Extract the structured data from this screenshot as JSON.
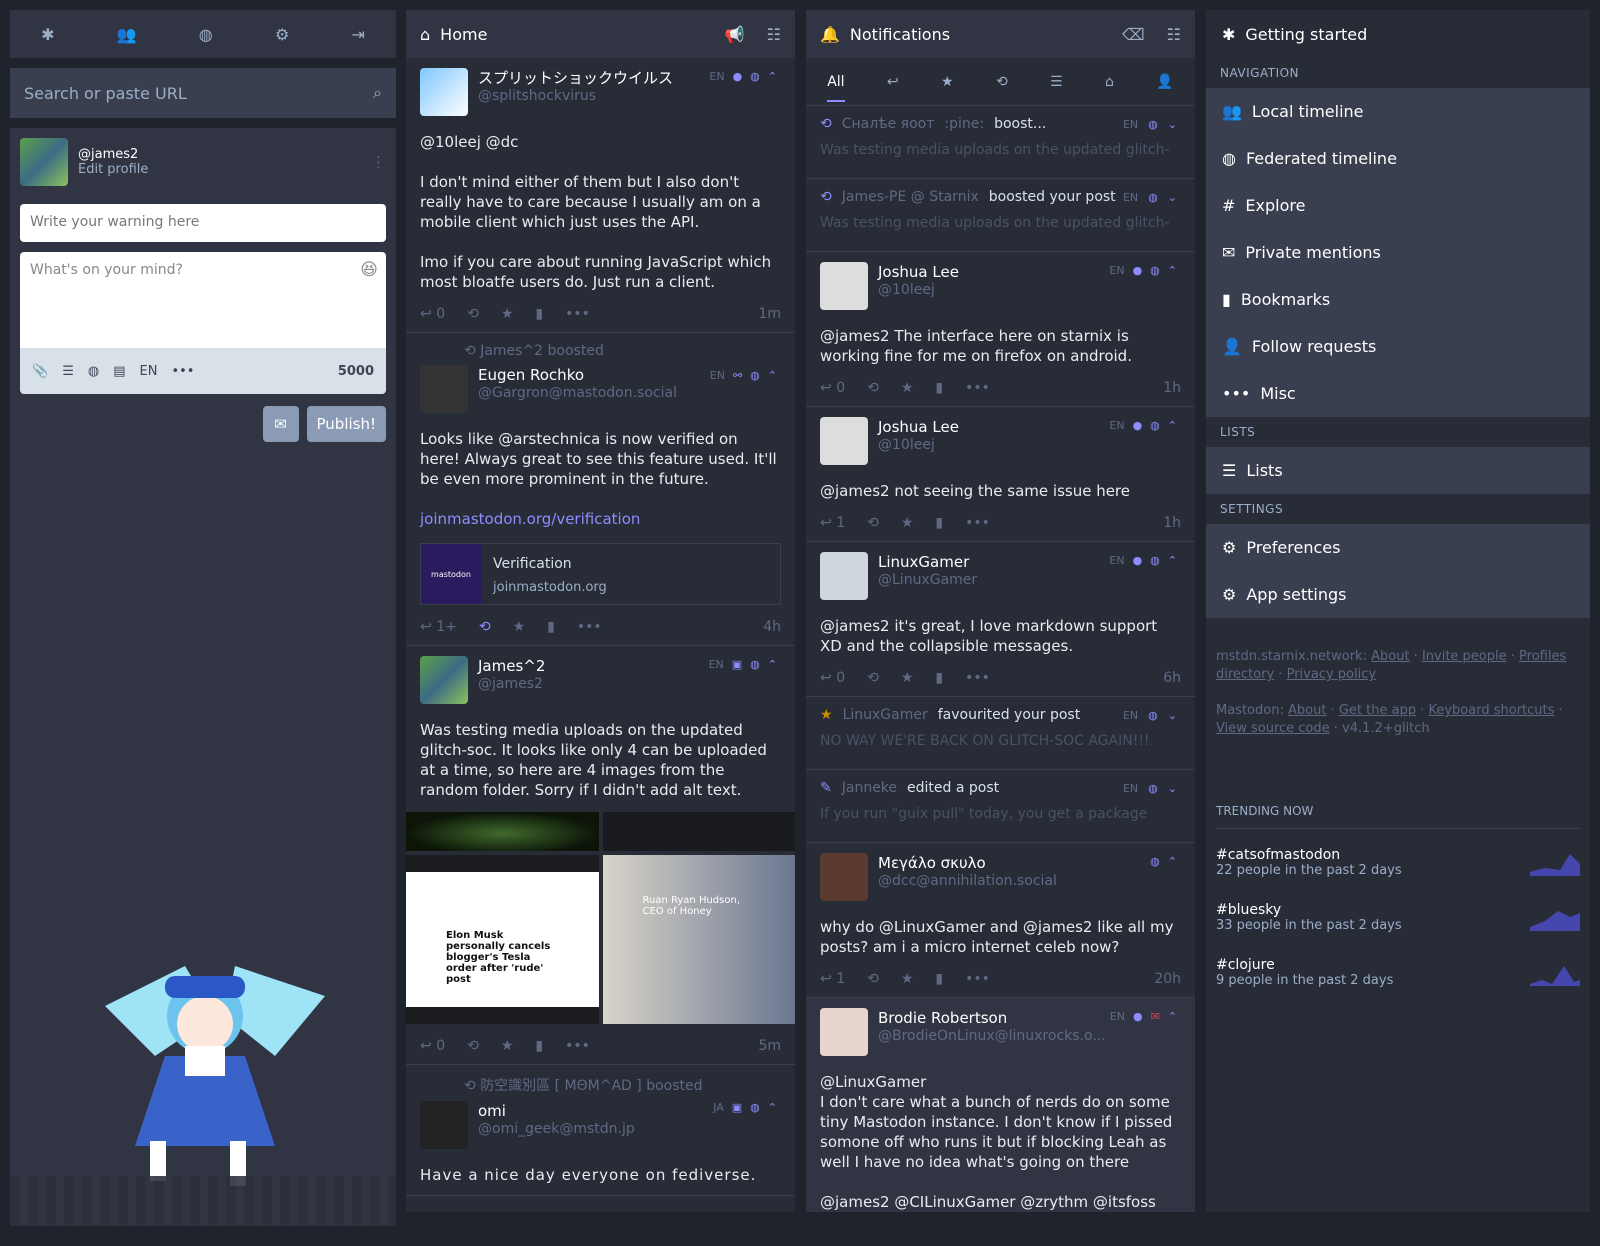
{
  "nav": {
    "icons": [
      "asterisk-icon",
      "users-icon",
      "globe-icon",
      "gears-icon",
      "logout-icon"
    ]
  },
  "search": {
    "placeholder": "Search or paste URL"
  },
  "composer": {
    "handle": "@james2",
    "edit": "Edit profile",
    "warning_ph": "Write your warning here",
    "text_ph": "What's on your mind?",
    "lang": "EN",
    "count": "5000",
    "publish": "Publish!"
  },
  "home": {
    "title": "Home",
    "s1": {
      "name": "スプリットショックウイルス",
      "handle": "@splitshockvirus",
      "lang": "EN",
      "p1": "@10leej @dc",
      "p2": "I don't mind either of them but I also don't really have to care because I usually am on a mobile client which just uses the API.",
      "p3": "Imo if you care about running JavaScript which most bloatfe users do.  Just run a client.",
      "replies": "0",
      "time": "1m"
    },
    "s2": {
      "booster": "James^2",
      "boosted": "boosted",
      "name": "Eugen Rochko",
      "handle": "@Gargron@mastodon.social",
      "lang": "EN",
      "p1": "Looks like @arstechnica is now verified on here! Always great to see this feature used. It'll be even more prominent in the future.",
      "link": "joinmastodon.org/verification",
      "card_title": "Verification",
      "card_site": "joinmastodon.org",
      "card_logo": "mastodon",
      "replies": "1+",
      "time": "4h"
    },
    "s3": {
      "name": "James^2",
      "handle": "@james2",
      "lang": "EN",
      "p1": "Was testing media uploads on the updated glitch-soc. It looks like only 4 can be uploaded at a time, so here are 4 images from the random folder. Sorry if I didn't add alt text.",
      "m3_text": "Elon Musk personally cancels blogger's Tesla order after 'rude' post",
      "m4_text": "Ruan Ryan Hudson, CEO of Honey",
      "replies": "0",
      "time": "5m"
    },
    "s4": {
      "booster": "防空識別區 [ MΘM^AD ]",
      "boosted": "boosted",
      "name": "omi",
      "handle": "@omi_geek@mstdn.jp",
      "lang": "JA",
      "p1": "Have a nice day everyone on fediverse."
    }
  },
  "notifications": {
    "title": "Notifications",
    "tab_all": "All",
    "n1": {
      "who": "Сналѣе яоот",
      "extra": ":pine:",
      "what": "boost...",
      "lang": "EN",
      "faded": "Was testing media uploads on the updated glitch-"
    },
    "n2": {
      "who": "James-PE @ Starnix",
      "what": "boosted your post",
      "lang": "EN",
      "faded": "Was testing media uploads on the updated glitch-"
    },
    "s1": {
      "name": "Joshua Lee",
      "handle": "@10leej",
      "lang": "EN",
      "p1": "@james2 The interface here on starnix is working fine for me on firefox on android.",
      "replies": "0",
      "time": "1h"
    },
    "s2": {
      "name": "Joshua Lee",
      "handle": "@10leej",
      "lang": "EN",
      "p1": "@james2 not seeing the same issue here",
      "replies": "1",
      "time": "1h"
    },
    "s3": {
      "name": "LinuxGamer",
      "handle": "@LinuxGamer",
      "lang": "EN",
      "p1": "@james2 it's great, I love markdown support XD and the collapsible messages.",
      "replies": "0",
      "time": "6h"
    },
    "n3": {
      "who": "LinuxGamer",
      "what": "favourited your post",
      "lang": "EN",
      "faded": "NO WAY WE'RE BACK ON GLITCH-SOC AGAIN!!!"
    },
    "n4": {
      "who": "Janneke",
      "what": "edited a post",
      "lang": "EN",
      "faded": "If you run \"guix pull\" today, you get a package"
    },
    "s4": {
      "name": "Μεγάλο σκυλο",
      "handle": "@dcc@annihilation.social",
      "p1": "why do @LinuxGamer and @james2 like all my posts? am i a micro internet celeb now?",
      "replies": "1",
      "time": "20h"
    },
    "s5": {
      "name": "Brodie Robertson",
      "handle": "@BrodieOnLinux@linuxrocks.o...",
      "lang": "EN",
      "p1": "@LinuxGamer",
      "p2": "I don't care what a bunch of nerds do on some tiny Mastodon instance. I don't know if I pissed somone off who runs it but if blocking Leah as well I have no idea what's going on there",
      "p3": "@james2 @CILinuxGamer @zrythm @itsfoss"
    }
  },
  "getting_started": {
    "title": "Getting started",
    "sec_nav": "NAVIGATION",
    "items": [
      "Local timeline",
      "Federated timeline",
      "Explore",
      "Private mentions",
      "Bookmarks",
      "Follow requests",
      "Misc"
    ],
    "sec_lists": "LISTS",
    "lists": "Lists",
    "sec_settings": "SETTINGS",
    "prefs": "Preferences",
    "app": "App settings",
    "foot1_server": "mstdn.starnix.network:",
    "foot1_links": [
      "About",
      "Invite people",
      "Profiles directory",
      "Privacy policy"
    ],
    "foot2_label": "Mastodon:",
    "foot2_links": [
      "About",
      "Get the app",
      "Keyboard shortcuts",
      "View source code"
    ],
    "version": "v4.1.2+glitch",
    "trending_h": "TRENDING NOW",
    "trends": [
      {
        "tag": "#catsofmastodon",
        "uses": "22 people in the past 2 days"
      },
      {
        "tag": "#bluesky",
        "uses": "33 people in the past 2 days"
      },
      {
        "tag": "#clojure",
        "uses": "9 people in the past 2 days"
      }
    ]
  },
  "colors": {
    "accent": "#8c8dff",
    "bg": "#1f232b",
    "panel": "#282c37"
  }
}
